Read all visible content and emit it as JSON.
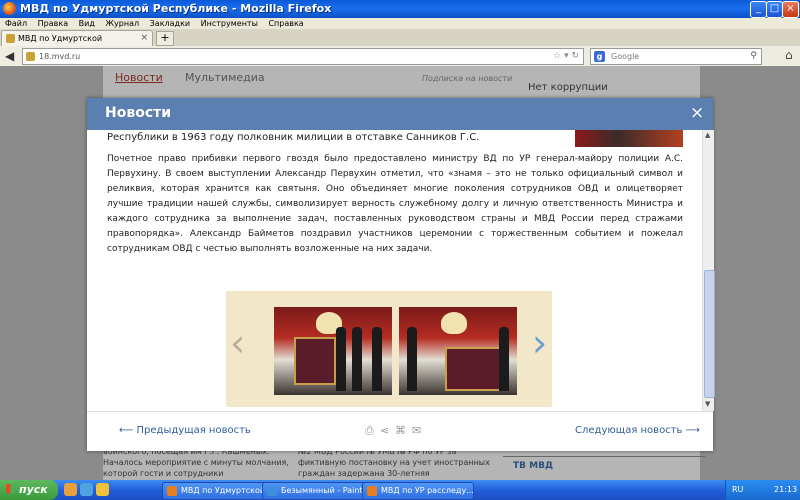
{
  "window": {
    "title": "МВД по Удмуртской Республике - Mozilla Firefox"
  },
  "menu": [
    "Файл",
    "Правка",
    "Вид",
    "Журнал",
    "Закладки",
    "Инструменты",
    "Справка"
  ],
  "tab": {
    "label": "МВД по Удмуртской Республике",
    "close": "×",
    "new": "+"
  },
  "nav": {
    "url": "18.mvd.ru",
    "search_engine": "Google",
    "search_placeholder": "Google"
  },
  "background": {
    "tabs": [
      "Новости",
      "Мультимедиа"
    ],
    "subscribe": "Подписка на новости",
    "right_link": "Нет коррупции",
    "left_text": "воинского, посещая им Г.Г. Кашменых. Началось мероприятие с минуты молчания, которой гости и сотрудники",
    "mid_text": "№2 МВД России № УМВ № РФ по УР за фиктивную постановку на учет иностранных граждан задержана 30-летняя",
    "tv_label": "ТВ МВД"
  },
  "modal": {
    "title": "Новости",
    "close": "×",
    "lead": "Республики в 1963 году полковник милиции в отставке Санников Г.С.",
    "paragraph": "Почетное право прибивки первого гвоздя было предоставлено министру ВД по УР генерал-майору полиции А.С. Первухину. В своем выступлении Александр Первухин отметил, что «знамя – это не только официальный символ и реликвия, которая хранится как святыня. Оно объединяет многие поколения сотрудников ОВД и олицетворяет лучшие традиции нашей службы, символизирует верность служебному долгу и личную ответственность Министра и каждого сотрудника за выполнение задач, поставленных руководством страны и МВД России перед стражами правопорядка». Александр Байметов поздравил участников церемонии с торжественным событием и пожелал сотрудникам ОВД с честью выполнять возложенные на них задачи.",
    "prev_label": "Предыдущая новость",
    "next_label": "Следующая новость",
    "prev_arrow": "⟵",
    "next_arrow": "⟶"
  },
  "taskbar": {
    "start": "пуск",
    "buttons": [
      "МВД по Удмуртской ...",
      "Безымянный - Paint",
      "МВД по УР расследу..."
    ],
    "lang": "RU",
    "clock": "21:13"
  },
  "colors": {
    "modal_header": "#5b7fb0",
    "link": "#2f5d9a",
    "accent_tab": "#7b2a20"
  }
}
